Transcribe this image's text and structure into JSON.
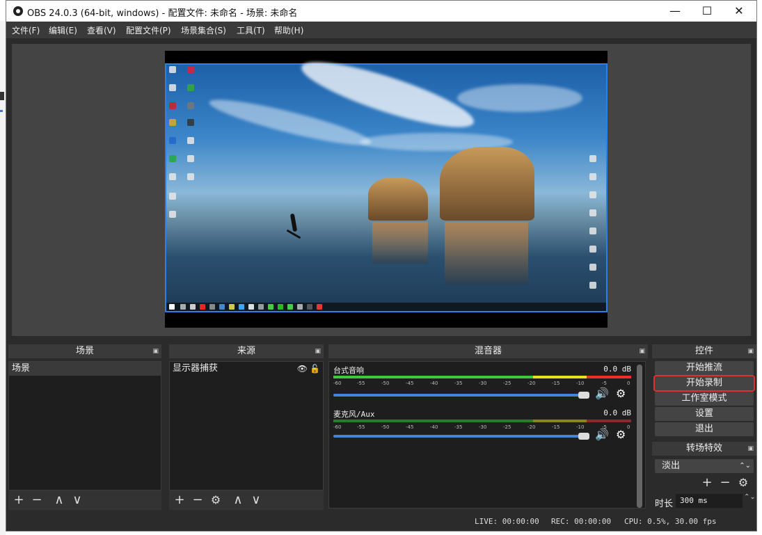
{
  "window": {
    "title": "OBS 24.0.3 (64-bit, windows) - 配置文件: 未命名 - 场景: 未命名"
  },
  "titlebar_buttons": {
    "minimize": "—",
    "maximize": "☐",
    "close": "✕"
  },
  "menu": [
    "文件(F)",
    "编辑(E)",
    "查看(V)",
    "配置文件(P)",
    "场景集合(S)",
    "工具(T)",
    "帮助(H)"
  ],
  "scenes": {
    "title": "场景",
    "items": [
      "场景"
    ]
  },
  "sources": {
    "title": "来源",
    "items": [
      "显示器捕获"
    ]
  },
  "mixer": {
    "title": "混音器",
    "scale": [
      "-60",
      "-55",
      "-50",
      "-45",
      "-40",
      "-35",
      "-30",
      "-25",
      "-20",
      "-15",
      "-10",
      "-5",
      "0"
    ],
    "channels": [
      {
        "name": "台式音响",
        "db": "0.0 dB",
        "volume": 1.0
      },
      {
        "name": "麦克风/Aux",
        "db": "0.0 dB",
        "volume": 1.0
      }
    ]
  },
  "controls": {
    "title": "控件",
    "start_streaming": "开始推流",
    "start_recording": "开始录制",
    "studio_mode": "工作室模式",
    "settings": "设置",
    "exit": "退出"
  },
  "transitions": {
    "title": "转场特效",
    "selected": "淡出",
    "duration_label": "时长",
    "duration_value": "300 ms"
  },
  "status": {
    "live": "LIVE: 00:00:00",
    "rec": "REC: 00:00:00",
    "cpu": "CPU: 0.5%, 30.00 fps"
  },
  "icons": {
    "add": "+",
    "remove": "−",
    "up": "∧",
    "down": "∨",
    "eye": "👁",
    "lock": "🔓",
    "speaker": "🔊",
    "gear": "⚙",
    "float": "▣",
    "spin": "⌃⌄"
  },
  "colors": {
    "accent": "#3f86d8",
    "highlight": "#e03030",
    "meter_green": "#3ec83e",
    "meter_yellow": "#e8e020",
    "meter_red": "#e83030"
  }
}
